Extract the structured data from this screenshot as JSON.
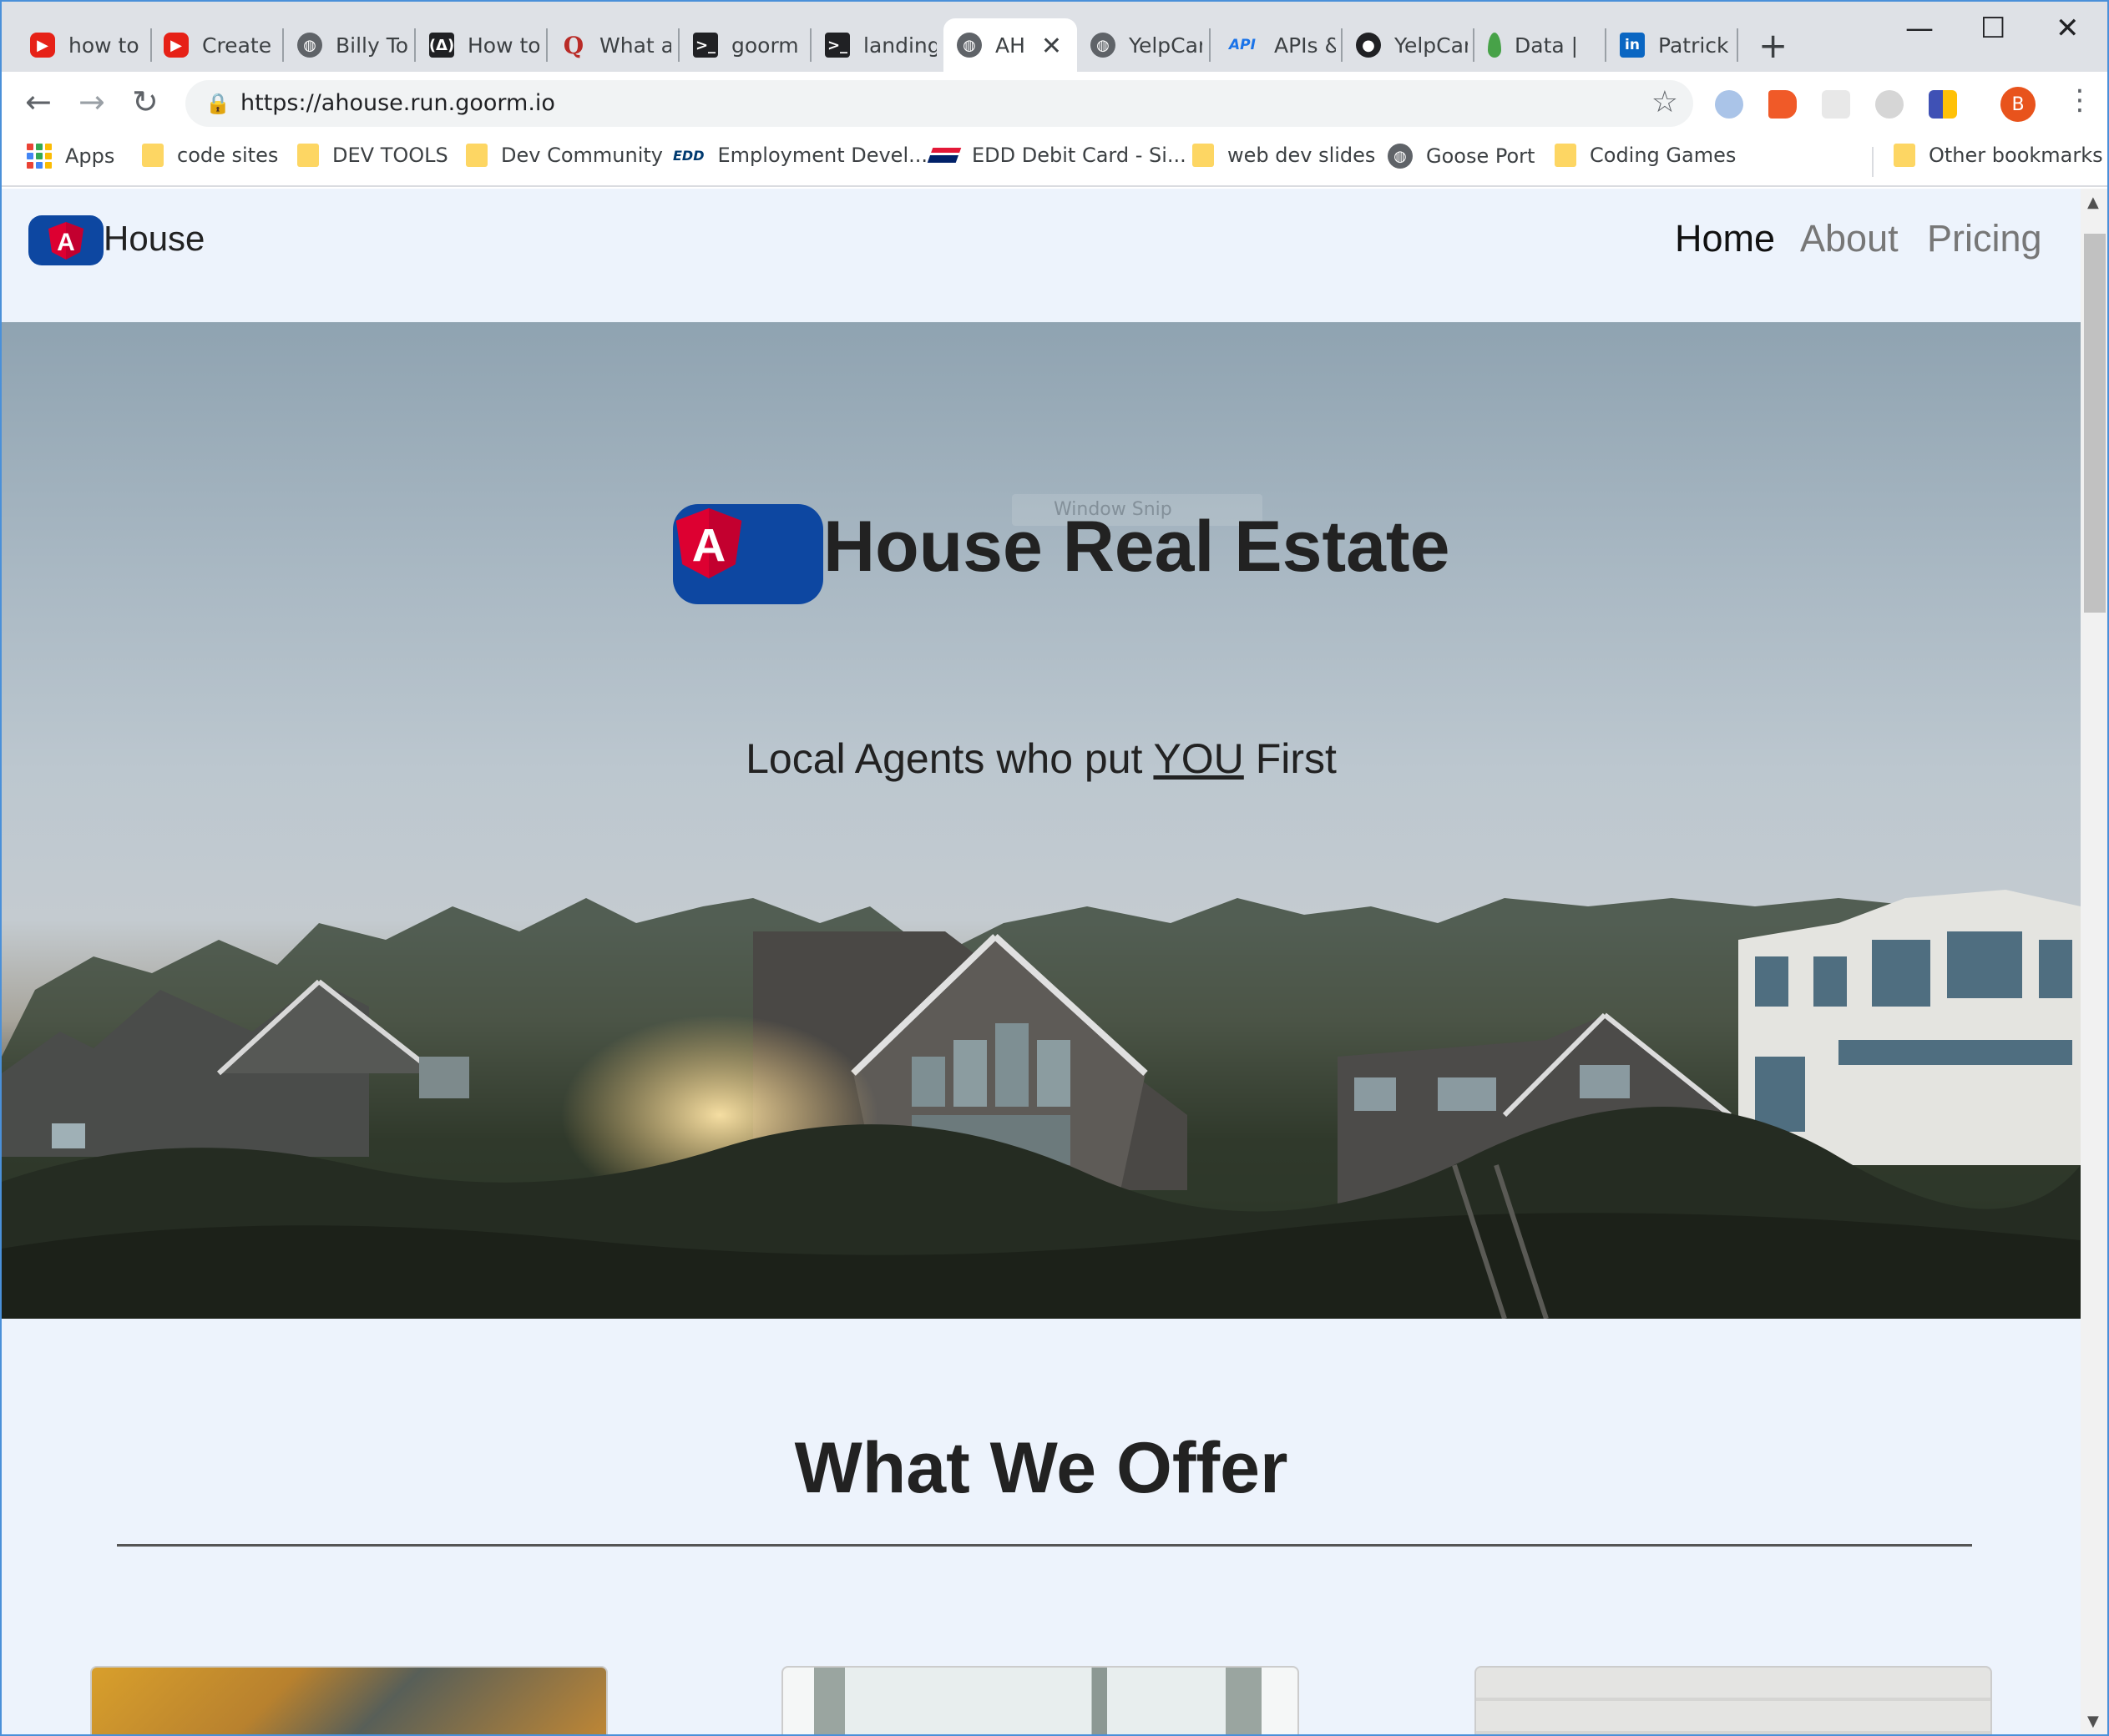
{
  "browser": {
    "tabs": [
      {
        "label": "how to",
        "icon": "youtube-icon"
      },
      {
        "label": "Create",
        "icon": "youtube-icon"
      },
      {
        "label": "Billy To",
        "icon": "globe-icon"
      },
      {
        "label": "How to",
        "icon": "freecodecamp-icon"
      },
      {
        "label": "What a",
        "icon": "quora-icon"
      },
      {
        "label": "goorm",
        "icon": "terminal-icon"
      },
      {
        "label": "landing",
        "icon": "terminal-icon"
      },
      {
        "label": "AH",
        "icon": "globe-icon",
        "active": true
      },
      {
        "label": "YelpCar",
        "icon": "globe-icon"
      },
      {
        "label": "APIs &",
        "icon": "api-icon"
      },
      {
        "label": "YelpCar",
        "icon": "github-icon"
      },
      {
        "label": "Data |",
        "icon": "mongodb-leaf-icon"
      },
      {
        "label": "Patrick",
        "icon": "linkedin-icon"
      }
    ],
    "tab_icon_text": {
      "q": "Q",
      "api": "API",
      "li": "in",
      "term": ">_"
    },
    "new_tab_glyph": "+",
    "close_glyph": "✕",
    "window_controls": {
      "minimize": "—",
      "maximize": "☐",
      "close": "✕"
    },
    "nav": {
      "back": "←",
      "forward": "→",
      "reload": "↻"
    },
    "url": "https://ahouse.run.goorm.io",
    "lock_glyph": "🔒",
    "star_glyph": "☆",
    "profile_initial": "B",
    "menu_glyph": "⋮",
    "bookmarks": [
      {
        "label": "Apps",
        "type": "apps"
      },
      {
        "label": "code sites",
        "type": "folder"
      },
      {
        "label": "DEV TOOLS",
        "type": "folder"
      },
      {
        "label": "Dev Community",
        "type": "folder"
      },
      {
        "label": "Employment Devel...",
        "type": "edd"
      },
      {
        "label": "EDD Debit Card - Si...",
        "type": "boa"
      },
      {
        "label": "web dev slides",
        "type": "folder"
      },
      {
        "label": "Goose Port",
        "type": "globe"
      },
      {
        "label": "Coding Games",
        "type": "folder"
      },
      {
        "label": "Other bookmarks",
        "type": "folder"
      }
    ],
    "edd_badge": "EDD"
  },
  "site": {
    "brand": "House",
    "logo_letter": "A",
    "nav_links": [
      {
        "label": "Home",
        "active": true
      },
      {
        "label": "About"
      },
      {
        "label": "Pricing"
      }
    ],
    "overlay_text": "Window Snip",
    "hero": {
      "title": "House Real Estate",
      "subtitle_before": "Local Agents who put ",
      "subtitle_emph": "YOU",
      "subtitle_after": " First"
    },
    "offer_title": "What We Offer"
  },
  "colors": {
    "brand_blue": "#0d47a1",
    "angular_red": "#dd0031",
    "page_bg": "#edf3fc"
  }
}
